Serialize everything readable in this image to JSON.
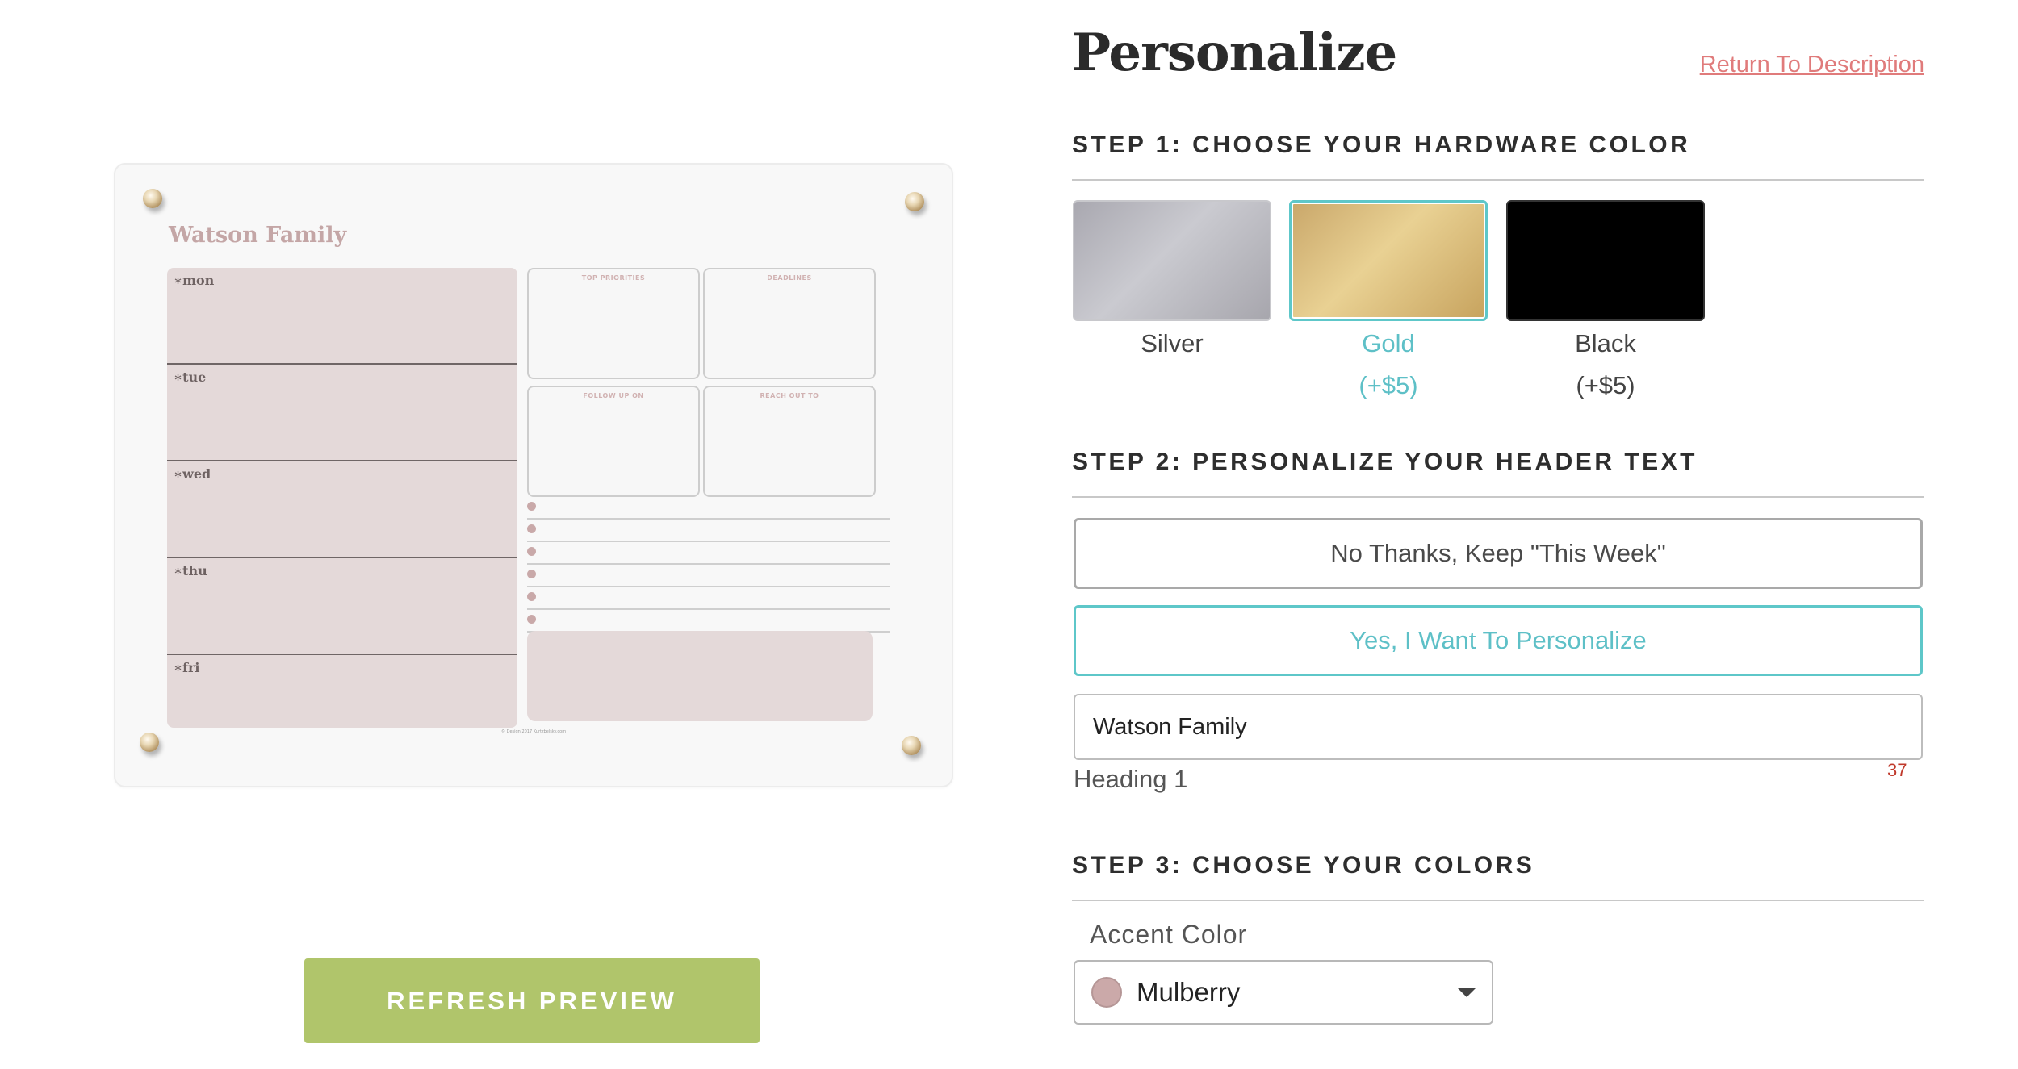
{
  "preview": {
    "board_title": "Watson Family",
    "days": [
      "mon",
      "tue",
      "wed",
      "thu",
      "fri"
    ],
    "boxes": [
      "TOP PRIORITIES",
      "DEADLINES",
      "FOLLOW UP ON",
      "REACH OUT TO"
    ],
    "footer": "© Design 2017 Kurtzbelsky.com",
    "refresh_label": "REFRESH PREVIEW"
  },
  "header": {
    "title": "Personalize",
    "return_link": "Return To Description"
  },
  "step1": {
    "title": "STEP 1: CHOOSE YOUR HARDWARE COLOR",
    "options": [
      {
        "name": "Silver",
        "price": ""
      },
      {
        "name": "Gold",
        "price": "(+$5)"
      },
      {
        "name": "Black",
        "price": "(+$5)"
      }
    ],
    "selected": "Gold"
  },
  "step2": {
    "title": "STEP 2: PERSONALIZE YOUR HEADER TEXT",
    "option_keep": "No Thanks, Keep \"This Week\"",
    "option_personalize": "Yes, I Want To Personalize",
    "input_value": "Watson Family",
    "helper": "Heading 1",
    "char_remaining": "37"
  },
  "step3": {
    "title": "STEP 3: CHOOSE YOUR COLORS",
    "accent_label": "Accent Color",
    "accent_value": "Mulberry",
    "accent_color": "#cba9a9"
  },
  "colors": {
    "accent_teal": "#5ec7c9",
    "button_green": "#b0c56b",
    "link_red": "#e07b7b"
  }
}
